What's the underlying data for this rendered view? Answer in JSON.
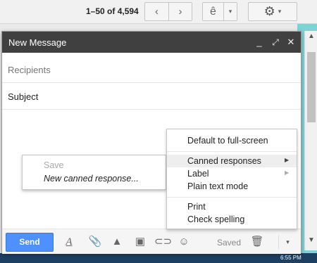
{
  "toolbar": {
    "pager_text": "1–50 of 4,594",
    "prev_icon": "‹",
    "next_icon": "›",
    "ime_label": "ê",
    "ime_dropdown": "▾",
    "settings_icon": "⚙",
    "settings_dropdown": "▾"
  },
  "scrollbar": {
    "up": "▲",
    "down": "▼"
  },
  "taskbar": {
    "clock": "6:55 PM"
  },
  "compose": {
    "title": "New Message",
    "minimize_icon": "_",
    "maximize_icon": "⤢",
    "close_icon": "✕",
    "recipients_placeholder": "Recipients",
    "subject_value": "Subject",
    "send_label": "Send",
    "format_icon": "A",
    "attach_icon": "📎",
    "drive_icon": "▲",
    "photo_icon": "▣",
    "link_icon": "⊂⊃",
    "emoji_icon": "☺",
    "saved_label": "Saved",
    "trash_icon": "🗑",
    "more_icon": "▾"
  },
  "menu": {
    "full_screen": "Default to full-screen",
    "canned_responses": "Canned responses",
    "label": "Label",
    "plain_text": "Plain text mode",
    "print": "Print",
    "check_spelling": "Check spelling",
    "submenu_arrow": "▶"
  },
  "submenu": {
    "save": "Save",
    "new_canned": "New canned response..."
  }
}
